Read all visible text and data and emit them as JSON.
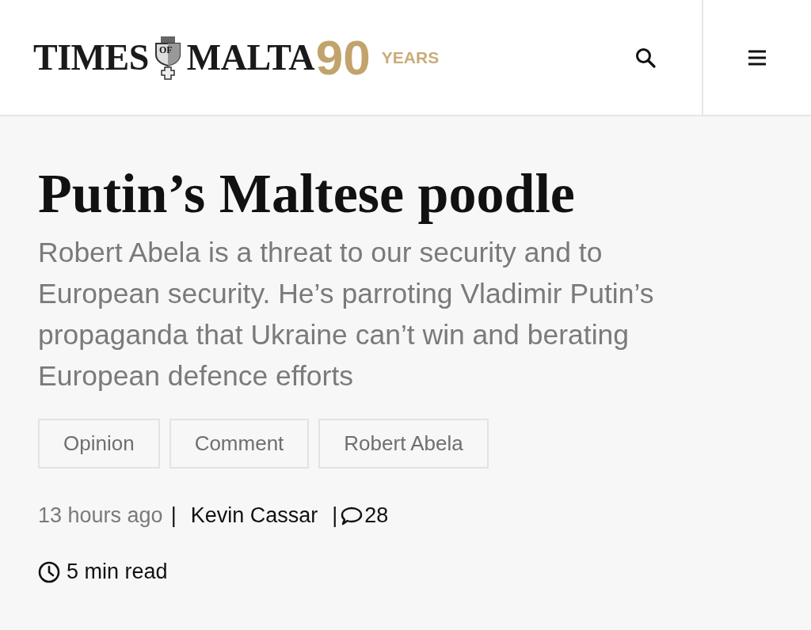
{
  "header": {
    "logo": {
      "word_1": "TIMES",
      "crest_text": "OF",
      "word_2": "MALTA",
      "anniversary_number": "90",
      "anniversary_word": "YEARS"
    }
  },
  "article": {
    "headline": "Putin’s Maltese poodle",
    "standfirst": "Robert Abela is a threat to our security and to European security. He’s parroting Vladimir Putin’s propaganda that Ukraine can’t win and berating European defence efforts",
    "tags": [
      "Opinion",
      "Comment",
      "Robert Abela"
    ],
    "meta": {
      "time": "13 hours ago",
      "separator_1": "|",
      "author": "Kevin Cassar",
      "separator_2": "|",
      "comments": "28"
    },
    "read_time": "5 min read"
  }
}
